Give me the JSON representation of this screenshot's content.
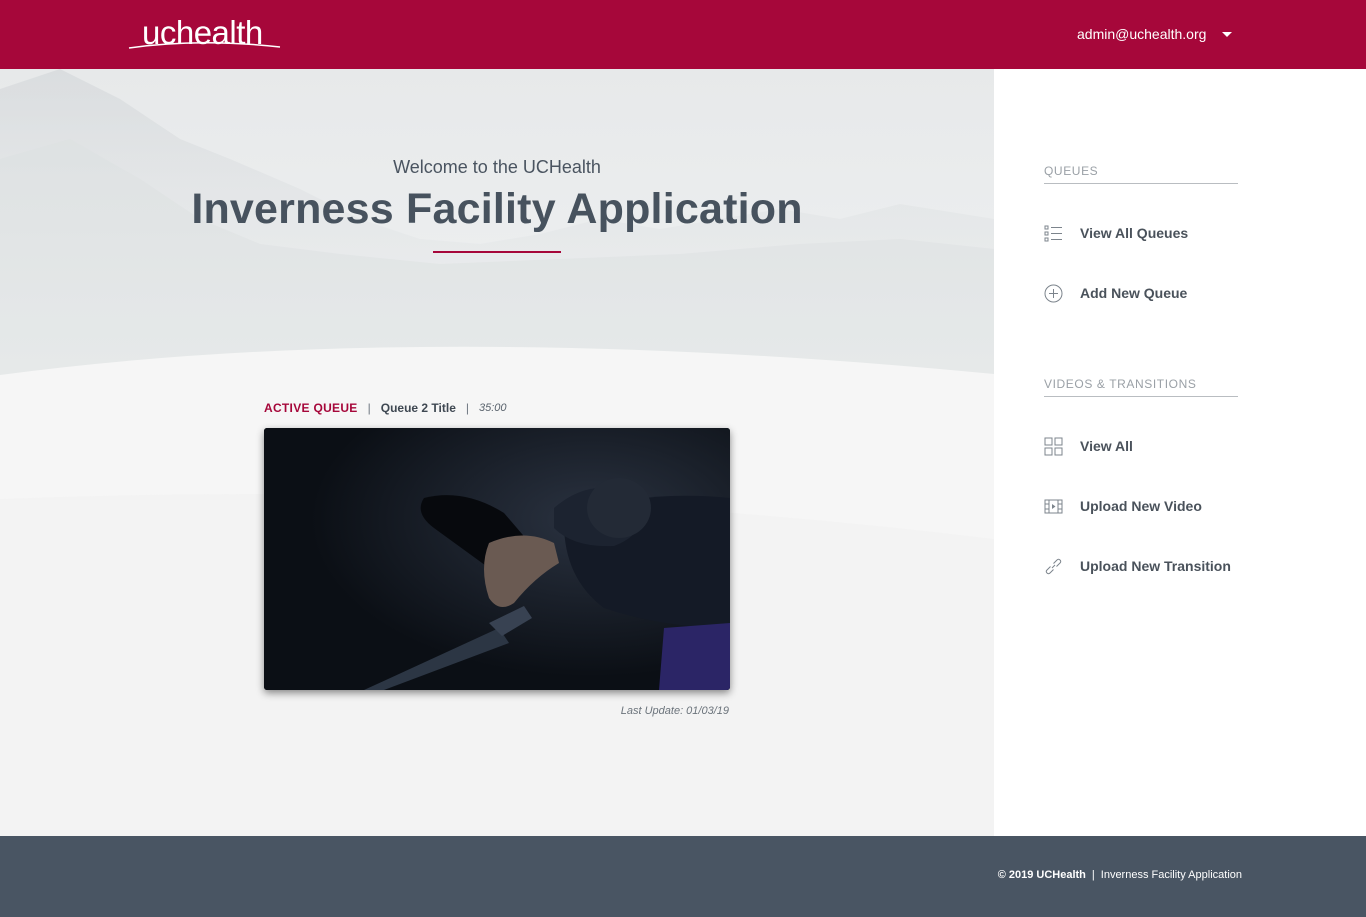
{
  "header": {
    "logo_text": "uchealth",
    "user_email": "admin@uchealth.org"
  },
  "hero": {
    "welcome": "Welcome to the UCHealth",
    "title": "Inverness Facility Application"
  },
  "active_queue": {
    "label": "ACTIVE QUEUE",
    "separator": "|",
    "queue_title": "Queue 2 Title",
    "duration": "35:00",
    "last_update": "Last Update: 01/03/19"
  },
  "sidebar": {
    "queues_heading": "QUEUES",
    "queue_items": [
      {
        "label": "View All Queues",
        "icon": "list-icon"
      },
      {
        "label": "Add New Queue",
        "icon": "plus-circle-icon"
      }
    ],
    "videos_heading": "VIDEOS & TRANSITIONS",
    "video_items": [
      {
        "label": "View All",
        "icon": "grid-icon"
      },
      {
        "label": "Upload New Video",
        "icon": "film-icon"
      },
      {
        "label": "Upload New Transition",
        "icon": "link-icon"
      }
    ]
  },
  "footer": {
    "copyright": "© 2019 UCHealth",
    "separator": "|",
    "app_name": "Inverness Facility Application"
  },
  "colors": {
    "brand": "#a6073a",
    "footer_bg": "#495563",
    "title_text": "#47525e"
  }
}
